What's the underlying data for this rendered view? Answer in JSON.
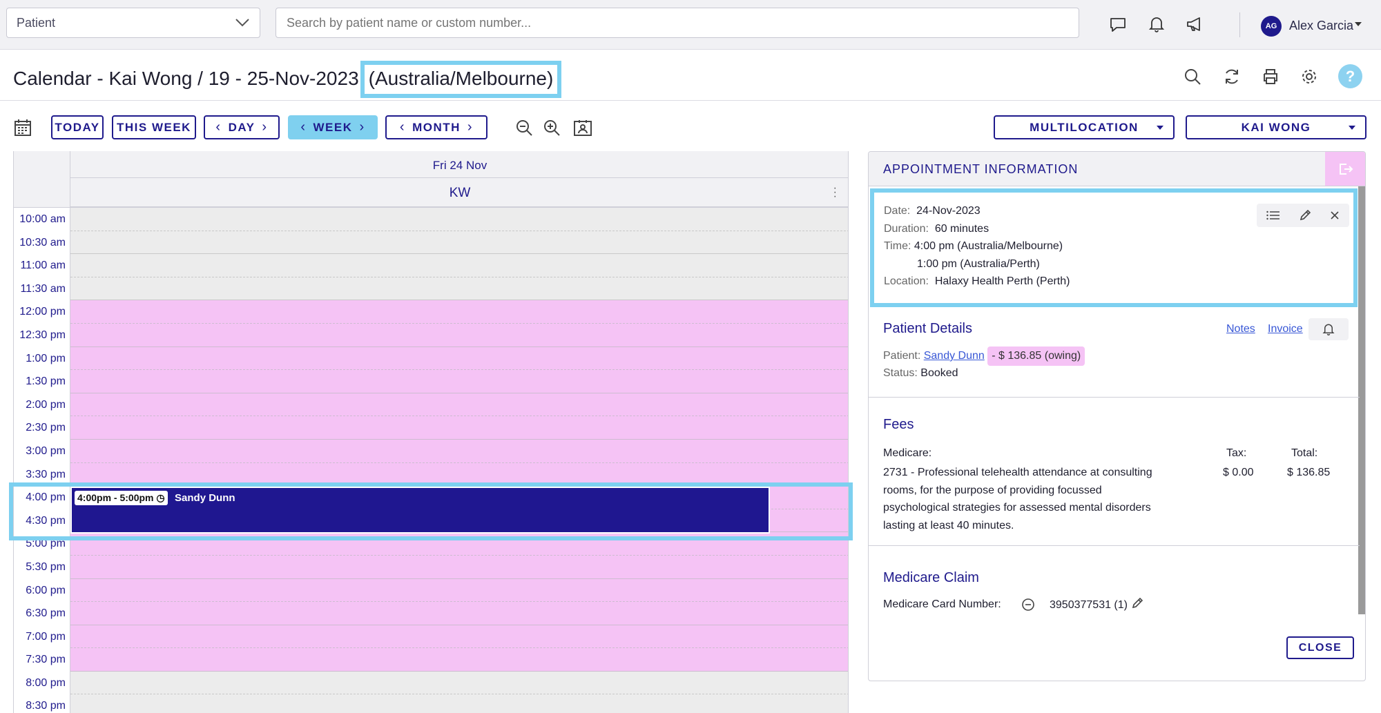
{
  "topbar": {
    "patient_select": "Patient",
    "search_placeholder": "Search by patient name or custom number...",
    "user_initials": "AG",
    "user_name": "Alex Garcia"
  },
  "title": {
    "main": "Calendar - Kai Wong / 19 - 25-Nov-2023",
    "timezone": "(Australia/Melbourne)"
  },
  "toolbar": {
    "today": "TODAY",
    "this_week": "THIS WEEK",
    "day": "DAY",
    "week": "WEEK",
    "month": "MONTH",
    "location_dropdown": "MULTILOCATION",
    "practitioner_dropdown": "KAI WONG"
  },
  "calendar": {
    "day_header": "Fri 24 Nov",
    "provider": "KW",
    "times": [
      "10:00 am",
      "10:30 am",
      "11:00 am",
      "11:30 am",
      "12:00 pm",
      "12:30 pm",
      "1:00 pm",
      "1:30 pm",
      "2:00 pm",
      "2:30 pm",
      "3:00 pm",
      "3:30 pm",
      "4:00 pm",
      "4:30 pm",
      "5:00 pm",
      "5:30 pm",
      "6:00 pm",
      "6:30 pm",
      "7:00 pm",
      "7:30 pm",
      "8:00 pm",
      "8:30 pm"
    ],
    "appointment": {
      "time": "4:00pm - 5:00pm",
      "patient": "Sandy Dunn"
    }
  },
  "panel": {
    "title": "APPOINTMENT INFORMATION",
    "info": {
      "date_label": "Date:",
      "date": "24-Nov-2023",
      "duration_label": "Duration:",
      "duration": "60 minutes",
      "time_label": "Time:",
      "time_local": "4:00 pm (Australia/Melbourne)",
      "time_alt": "1:00 pm (Australia/Perth)",
      "location_label": "Location:",
      "location": "Halaxy Health Perth (Perth)"
    },
    "patient_details": {
      "title": "Patient Details",
      "notes": "Notes",
      "invoice": "Invoice",
      "patient_label": "Patient:",
      "patient": "Sandy Dunn",
      "owing": "- $ 136.85 (owing)",
      "status_label": "Status:",
      "status": "Booked"
    },
    "fees": {
      "title": "Fees",
      "medicare_label": "Medicare:",
      "tax_label": "Tax:",
      "total_label": "Total:",
      "item_line1": "2731 - Professional telehealth attendance at consulting",
      "item_line2": "rooms, for the purpose of providing focussed",
      "item_line3": "psychological strategies for assessed mental disorders",
      "item_line4": "lasting at least 40 minutes.",
      "tax": "$ 0.00",
      "total": "$ 136.85"
    },
    "medicare_claim": {
      "title": "Medicare Claim",
      "card_label": "Medicare Card Number:",
      "card_number": "3950377531 (1)"
    },
    "close": "CLOSE"
  }
}
